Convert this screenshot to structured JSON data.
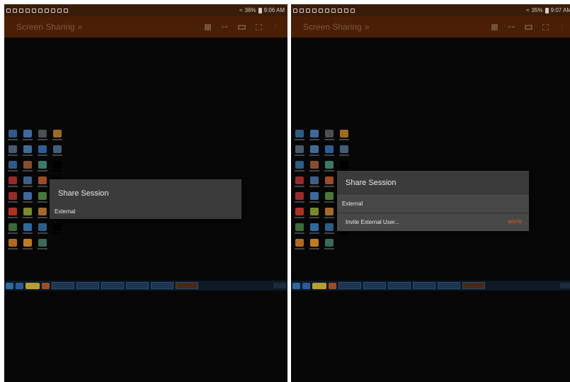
{
  "left": {
    "status": {
      "battery": "36%",
      "time": "9:06 AM"
    },
    "appbar": {
      "title": "Screen Sharing",
      "chevron": "»"
    },
    "dialog": {
      "title": "Share Session",
      "item": "External"
    }
  },
  "right": {
    "status": {
      "battery": "35%",
      "time": "9:07 AM"
    },
    "appbar": {
      "title": "Screen Sharing",
      "chevron": "»"
    },
    "dialog": {
      "title": "Share Session",
      "item": "External",
      "sub_item": "Invite External User...",
      "sub_action": "INVITE"
    }
  },
  "icons": {
    "actions": [
      "stop-square-icon",
      "key-icon",
      "keyboard-icon",
      "fullscreen-icon",
      "overflow-menu-icon"
    ]
  },
  "colors": {
    "status_bar": "#3a1d08",
    "app_bar": "#4a1f06",
    "dialog": "#3b3b3b",
    "accent": "#c25a1f"
  }
}
